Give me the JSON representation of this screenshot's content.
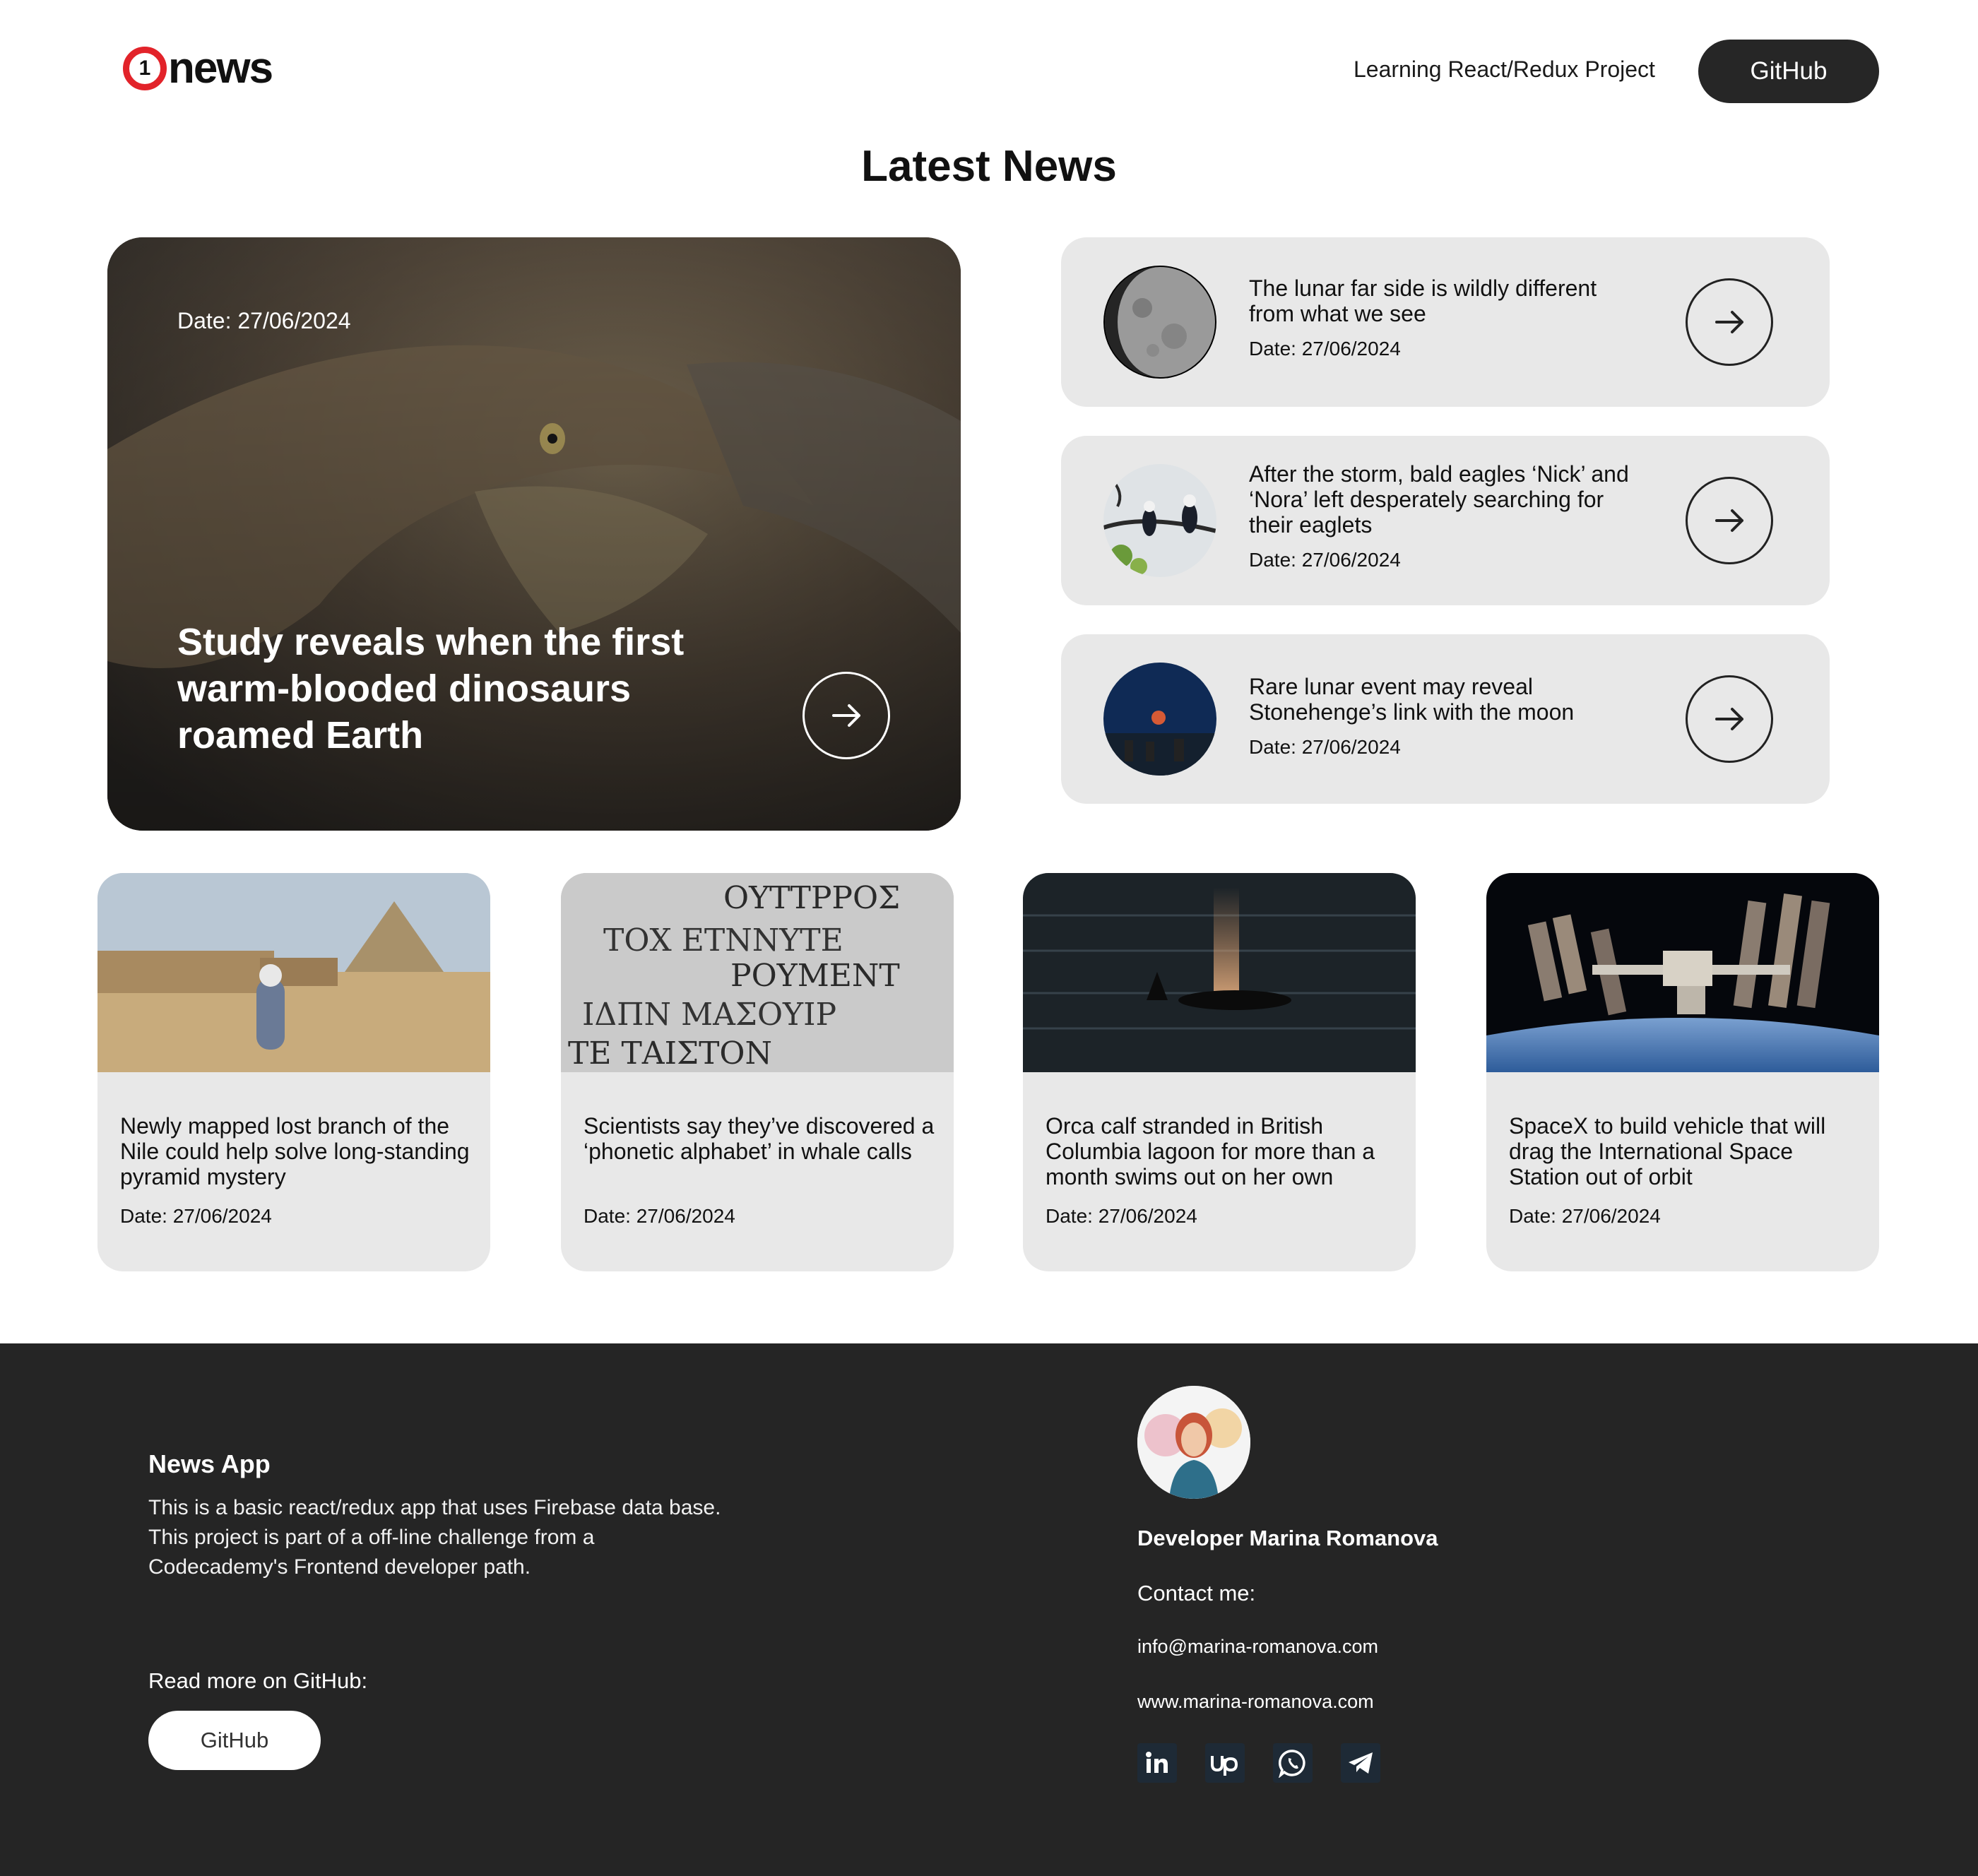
{
  "header": {
    "logo_text": "news",
    "logo_badge": "1",
    "subtitle": "Learning React/Redux Project",
    "github_label": "GitHub"
  },
  "page_title": "Latest News",
  "hero": {
    "date": "Date: 27/06/2024",
    "title": "Study reveals when the first warm-blooded dinosaurs roamed Earth",
    "arrow_icon": "arrow-right-icon"
  },
  "side_news": [
    {
      "title": "The lunar far side is wildly different from what we see",
      "date": "Date: 27/06/2024"
    },
    {
      "title": "After the storm, bald eagles ‘Nick’ and ‘Nora’ left desperately searching for their eaglets",
      "date": "Date: 27/06/2024"
    },
    {
      "title": "Rare lunar event may reveal Stonehenge’s link with the moon",
      "date": "Date: 27/06/2024"
    }
  ],
  "cards": [
    {
      "title": "Newly mapped lost branch of the Nile could help solve long-standing pyramid mystery",
      "date": "Date: 27/06/2024"
    },
    {
      "title": "Scientists say they’ve discovered a ‘phonetic alphabet’ in whale calls",
      "date": "Date: 27/06/2024"
    },
    {
      "title": "Orca calf stranded in British Columbia lagoon for more than a month swims out on her own",
      "date": "Date: 27/06/2024"
    },
    {
      "title": "SpaceX to build vehicle that will drag the International Space Station out of orbit",
      "date": "Date: 27/06/2024"
    }
  ],
  "footer": {
    "app_title": "News App",
    "description": "This is a basic react/redux app that uses Firebase data base. This project is part of a off-line challenge from a Codecademy's Frontend developer path.",
    "read_more": "Read more on GitHub:",
    "github_label": "GitHub",
    "developer": "Developer Marina Romanova",
    "contact": "Contact me:",
    "email": "info@marina-romanova.com",
    "website": "www.marina-romanova.com",
    "social_icons": [
      "linkedin-icon",
      "upwork-icon",
      "whatsapp-icon",
      "telegram-icon"
    ]
  },
  "colors": {
    "brand_red": "#e2232a",
    "dark": "#252525",
    "card_bg": "#e8e8e8"
  }
}
